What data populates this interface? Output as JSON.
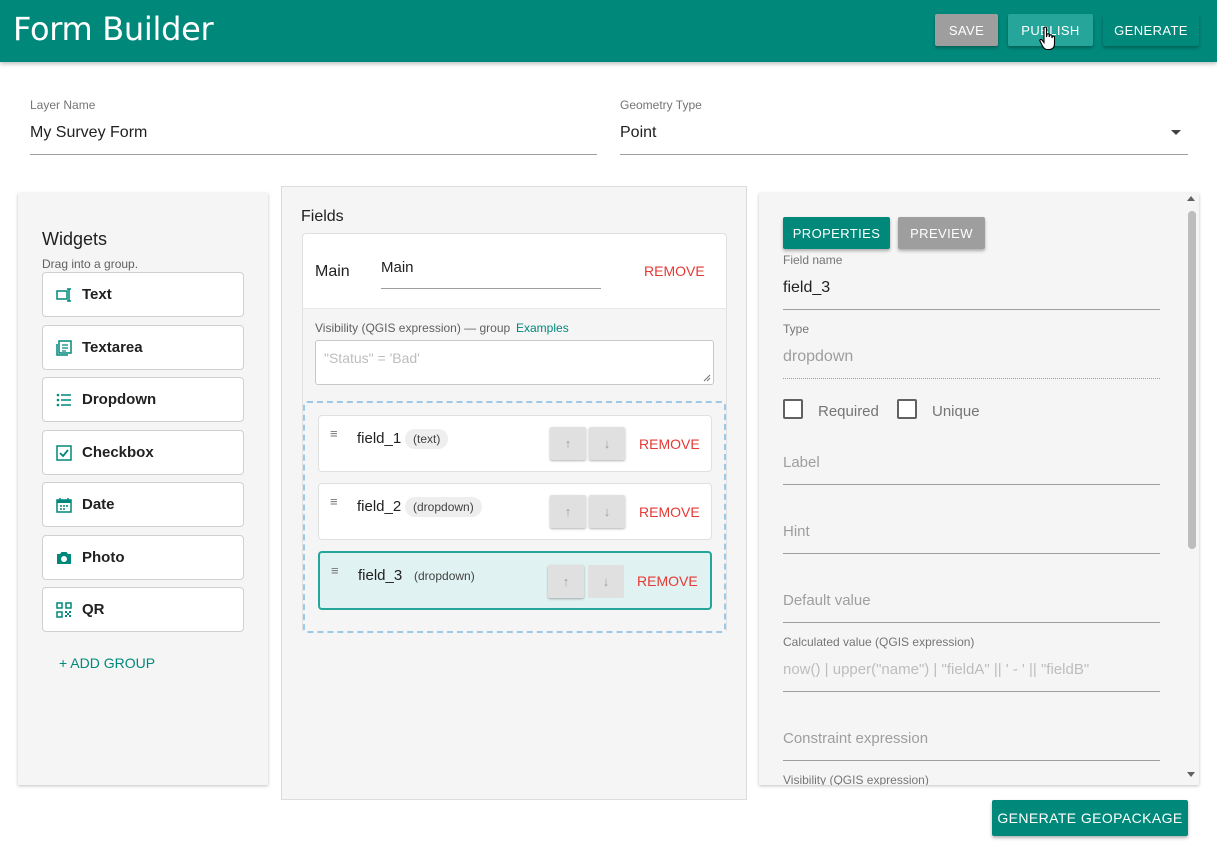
{
  "header": {
    "title": "Form Builder",
    "save_label": "SAVE",
    "publish_label": "PUBLISH",
    "generate_label": "GENERATE"
  },
  "layer": {
    "label": "Layer Name",
    "value": "My Survey Form"
  },
  "geometry": {
    "label": "Geometry Type",
    "value": "Point"
  },
  "widgets": {
    "title": "Widgets",
    "subtitle": "Drag into a group.",
    "items": [
      {
        "label": "Text",
        "icon": "text-field-icon"
      },
      {
        "label": "Textarea",
        "icon": "textarea-icon"
      },
      {
        "label": "Dropdown",
        "icon": "list-icon"
      },
      {
        "label": "Checkbox",
        "icon": "checkbox-icon"
      },
      {
        "label": "Date",
        "icon": "calendar-icon"
      },
      {
        "label": "Photo",
        "icon": "camera-icon"
      },
      {
        "label": "QR",
        "icon": "qr-code-icon"
      }
    ],
    "add_group_label": "+ ADD GROUP"
  },
  "fields_panel": {
    "title": "Fields",
    "group": {
      "name": "Main",
      "name_value": "Main",
      "remove_label": "REMOVE",
      "visibility_label": "Visibility (QGIS expression) — group",
      "examples_label": "Examples",
      "visibility_placeholder": "\"Status\" = 'Bad'"
    },
    "fields": [
      {
        "name": "field_1",
        "type": "(text)",
        "up": "↑",
        "down": "↓",
        "remove": "REMOVE"
      },
      {
        "name": "field_2",
        "type": "(dropdown)",
        "up": "↑",
        "down": "↓",
        "remove": "REMOVE"
      },
      {
        "name": "field_3",
        "type": "(dropdown)",
        "up": "↑",
        "down": "↓",
        "remove": "REMOVE"
      }
    ]
  },
  "properties": {
    "properties_tab": "PROPERTIES",
    "preview_tab": "PREVIEW",
    "field_name_label": "Field name",
    "field_name_value": "field_3",
    "type_label": "Type",
    "type_value": "dropdown",
    "required_label": "Required",
    "unique_label": "Unique",
    "label_placeholder": "Label",
    "hint_placeholder": "Hint",
    "default_placeholder": "Default value",
    "calculated_label": "Calculated value (QGIS expression)",
    "calculated_placeholder": "now() | upper(\"name\") | \"fieldA\" || ' - ' || \"fieldB\"",
    "constraint_placeholder": "Constraint expression",
    "visibility_label": "Visibility (QGIS expression)"
  },
  "footer": {
    "generate_geopackage_label": "GENERATE GEOPACKAGE"
  }
}
